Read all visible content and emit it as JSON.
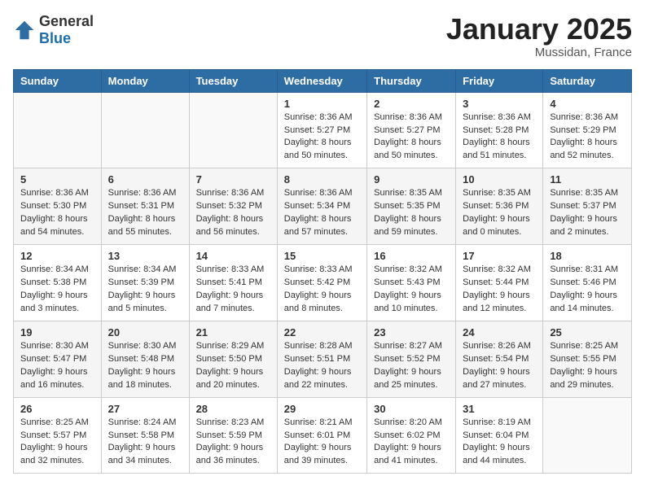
{
  "logo": {
    "general": "General",
    "blue": "Blue"
  },
  "header": {
    "month": "January 2025",
    "location": "Mussidan, France"
  },
  "weekdays": [
    "Sunday",
    "Monday",
    "Tuesday",
    "Wednesday",
    "Thursday",
    "Friday",
    "Saturday"
  ],
  "weeks": [
    [
      {
        "day": "",
        "sunrise": "",
        "sunset": "",
        "daylight": ""
      },
      {
        "day": "",
        "sunrise": "",
        "sunset": "",
        "daylight": ""
      },
      {
        "day": "",
        "sunrise": "",
        "sunset": "",
        "daylight": ""
      },
      {
        "day": "1",
        "sunrise": "Sunrise: 8:36 AM",
        "sunset": "Sunset: 5:27 PM",
        "daylight": "Daylight: 8 hours and 50 minutes."
      },
      {
        "day": "2",
        "sunrise": "Sunrise: 8:36 AM",
        "sunset": "Sunset: 5:27 PM",
        "daylight": "Daylight: 8 hours and 50 minutes."
      },
      {
        "day": "3",
        "sunrise": "Sunrise: 8:36 AM",
        "sunset": "Sunset: 5:28 PM",
        "daylight": "Daylight: 8 hours and 51 minutes."
      },
      {
        "day": "4",
        "sunrise": "Sunrise: 8:36 AM",
        "sunset": "Sunset: 5:29 PM",
        "daylight": "Daylight: 8 hours and 52 minutes."
      }
    ],
    [
      {
        "day": "5",
        "sunrise": "Sunrise: 8:36 AM",
        "sunset": "Sunset: 5:30 PM",
        "daylight": "Daylight: 8 hours and 54 minutes."
      },
      {
        "day": "6",
        "sunrise": "Sunrise: 8:36 AM",
        "sunset": "Sunset: 5:31 PM",
        "daylight": "Daylight: 8 hours and 55 minutes."
      },
      {
        "day": "7",
        "sunrise": "Sunrise: 8:36 AM",
        "sunset": "Sunset: 5:32 PM",
        "daylight": "Daylight: 8 hours and 56 minutes."
      },
      {
        "day": "8",
        "sunrise": "Sunrise: 8:36 AM",
        "sunset": "Sunset: 5:34 PM",
        "daylight": "Daylight: 8 hours and 57 minutes."
      },
      {
        "day": "9",
        "sunrise": "Sunrise: 8:35 AM",
        "sunset": "Sunset: 5:35 PM",
        "daylight": "Daylight: 8 hours and 59 minutes."
      },
      {
        "day": "10",
        "sunrise": "Sunrise: 8:35 AM",
        "sunset": "Sunset: 5:36 PM",
        "daylight": "Daylight: 9 hours and 0 minutes."
      },
      {
        "day": "11",
        "sunrise": "Sunrise: 8:35 AM",
        "sunset": "Sunset: 5:37 PM",
        "daylight": "Daylight: 9 hours and 2 minutes."
      }
    ],
    [
      {
        "day": "12",
        "sunrise": "Sunrise: 8:34 AM",
        "sunset": "Sunset: 5:38 PM",
        "daylight": "Daylight: 9 hours and 3 minutes."
      },
      {
        "day": "13",
        "sunrise": "Sunrise: 8:34 AM",
        "sunset": "Sunset: 5:39 PM",
        "daylight": "Daylight: 9 hours and 5 minutes."
      },
      {
        "day": "14",
        "sunrise": "Sunrise: 8:33 AM",
        "sunset": "Sunset: 5:41 PM",
        "daylight": "Daylight: 9 hours and 7 minutes."
      },
      {
        "day": "15",
        "sunrise": "Sunrise: 8:33 AM",
        "sunset": "Sunset: 5:42 PM",
        "daylight": "Daylight: 9 hours and 8 minutes."
      },
      {
        "day": "16",
        "sunrise": "Sunrise: 8:32 AM",
        "sunset": "Sunset: 5:43 PM",
        "daylight": "Daylight: 9 hours and 10 minutes."
      },
      {
        "day": "17",
        "sunrise": "Sunrise: 8:32 AM",
        "sunset": "Sunset: 5:44 PM",
        "daylight": "Daylight: 9 hours and 12 minutes."
      },
      {
        "day": "18",
        "sunrise": "Sunrise: 8:31 AM",
        "sunset": "Sunset: 5:46 PM",
        "daylight": "Daylight: 9 hours and 14 minutes."
      }
    ],
    [
      {
        "day": "19",
        "sunrise": "Sunrise: 8:30 AM",
        "sunset": "Sunset: 5:47 PM",
        "daylight": "Daylight: 9 hours and 16 minutes."
      },
      {
        "day": "20",
        "sunrise": "Sunrise: 8:30 AM",
        "sunset": "Sunset: 5:48 PM",
        "daylight": "Daylight: 9 hours and 18 minutes."
      },
      {
        "day": "21",
        "sunrise": "Sunrise: 8:29 AM",
        "sunset": "Sunset: 5:50 PM",
        "daylight": "Daylight: 9 hours and 20 minutes."
      },
      {
        "day": "22",
        "sunrise": "Sunrise: 8:28 AM",
        "sunset": "Sunset: 5:51 PM",
        "daylight": "Daylight: 9 hours and 22 minutes."
      },
      {
        "day": "23",
        "sunrise": "Sunrise: 8:27 AM",
        "sunset": "Sunset: 5:52 PM",
        "daylight": "Daylight: 9 hours and 25 minutes."
      },
      {
        "day": "24",
        "sunrise": "Sunrise: 8:26 AM",
        "sunset": "Sunset: 5:54 PM",
        "daylight": "Daylight: 9 hours and 27 minutes."
      },
      {
        "day": "25",
        "sunrise": "Sunrise: 8:25 AM",
        "sunset": "Sunset: 5:55 PM",
        "daylight": "Daylight: 9 hours and 29 minutes."
      }
    ],
    [
      {
        "day": "26",
        "sunrise": "Sunrise: 8:25 AM",
        "sunset": "Sunset: 5:57 PM",
        "daylight": "Daylight: 9 hours and 32 minutes."
      },
      {
        "day": "27",
        "sunrise": "Sunrise: 8:24 AM",
        "sunset": "Sunset: 5:58 PM",
        "daylight": "Daylight: 9 hours and 34 minutes."
      },
      {
        "day": "28",
        "sunrise": "Sunrise: 8:23 AM",
        "sunset": "Sunset: 5:59 PM",
        "daylight": "Daylight: 9 hours and 36 minutes."
      },
      {
        "day": "29",
        "sunrise": "Sunrise: 8:21 AM",
        "sunset": "Sunset: 6:01 PM",
        "daylight": "Daylight: 9 hours and 39 minutes."
      },
      {
        "day": "30",
        "sunrise": "Sunrise: 8:20 AM",
        "sunset": "Sunset: 6:02 PM",
        "daylight": "Daylight: 9 hours and 41 minutes."
      },
      {
        "day": "31",
        "sunrise": "Sunrise: 8:19 AM",
        "sunset": "Sunset: 6:04 PM",
        "daylight": "Daylight: 9 hours and 44 minutes."
      },
      {
        "day": "",
        "sunrise": "",
        "sunset": "",
        "daylight": ""
      }
    ]
  ]
}
